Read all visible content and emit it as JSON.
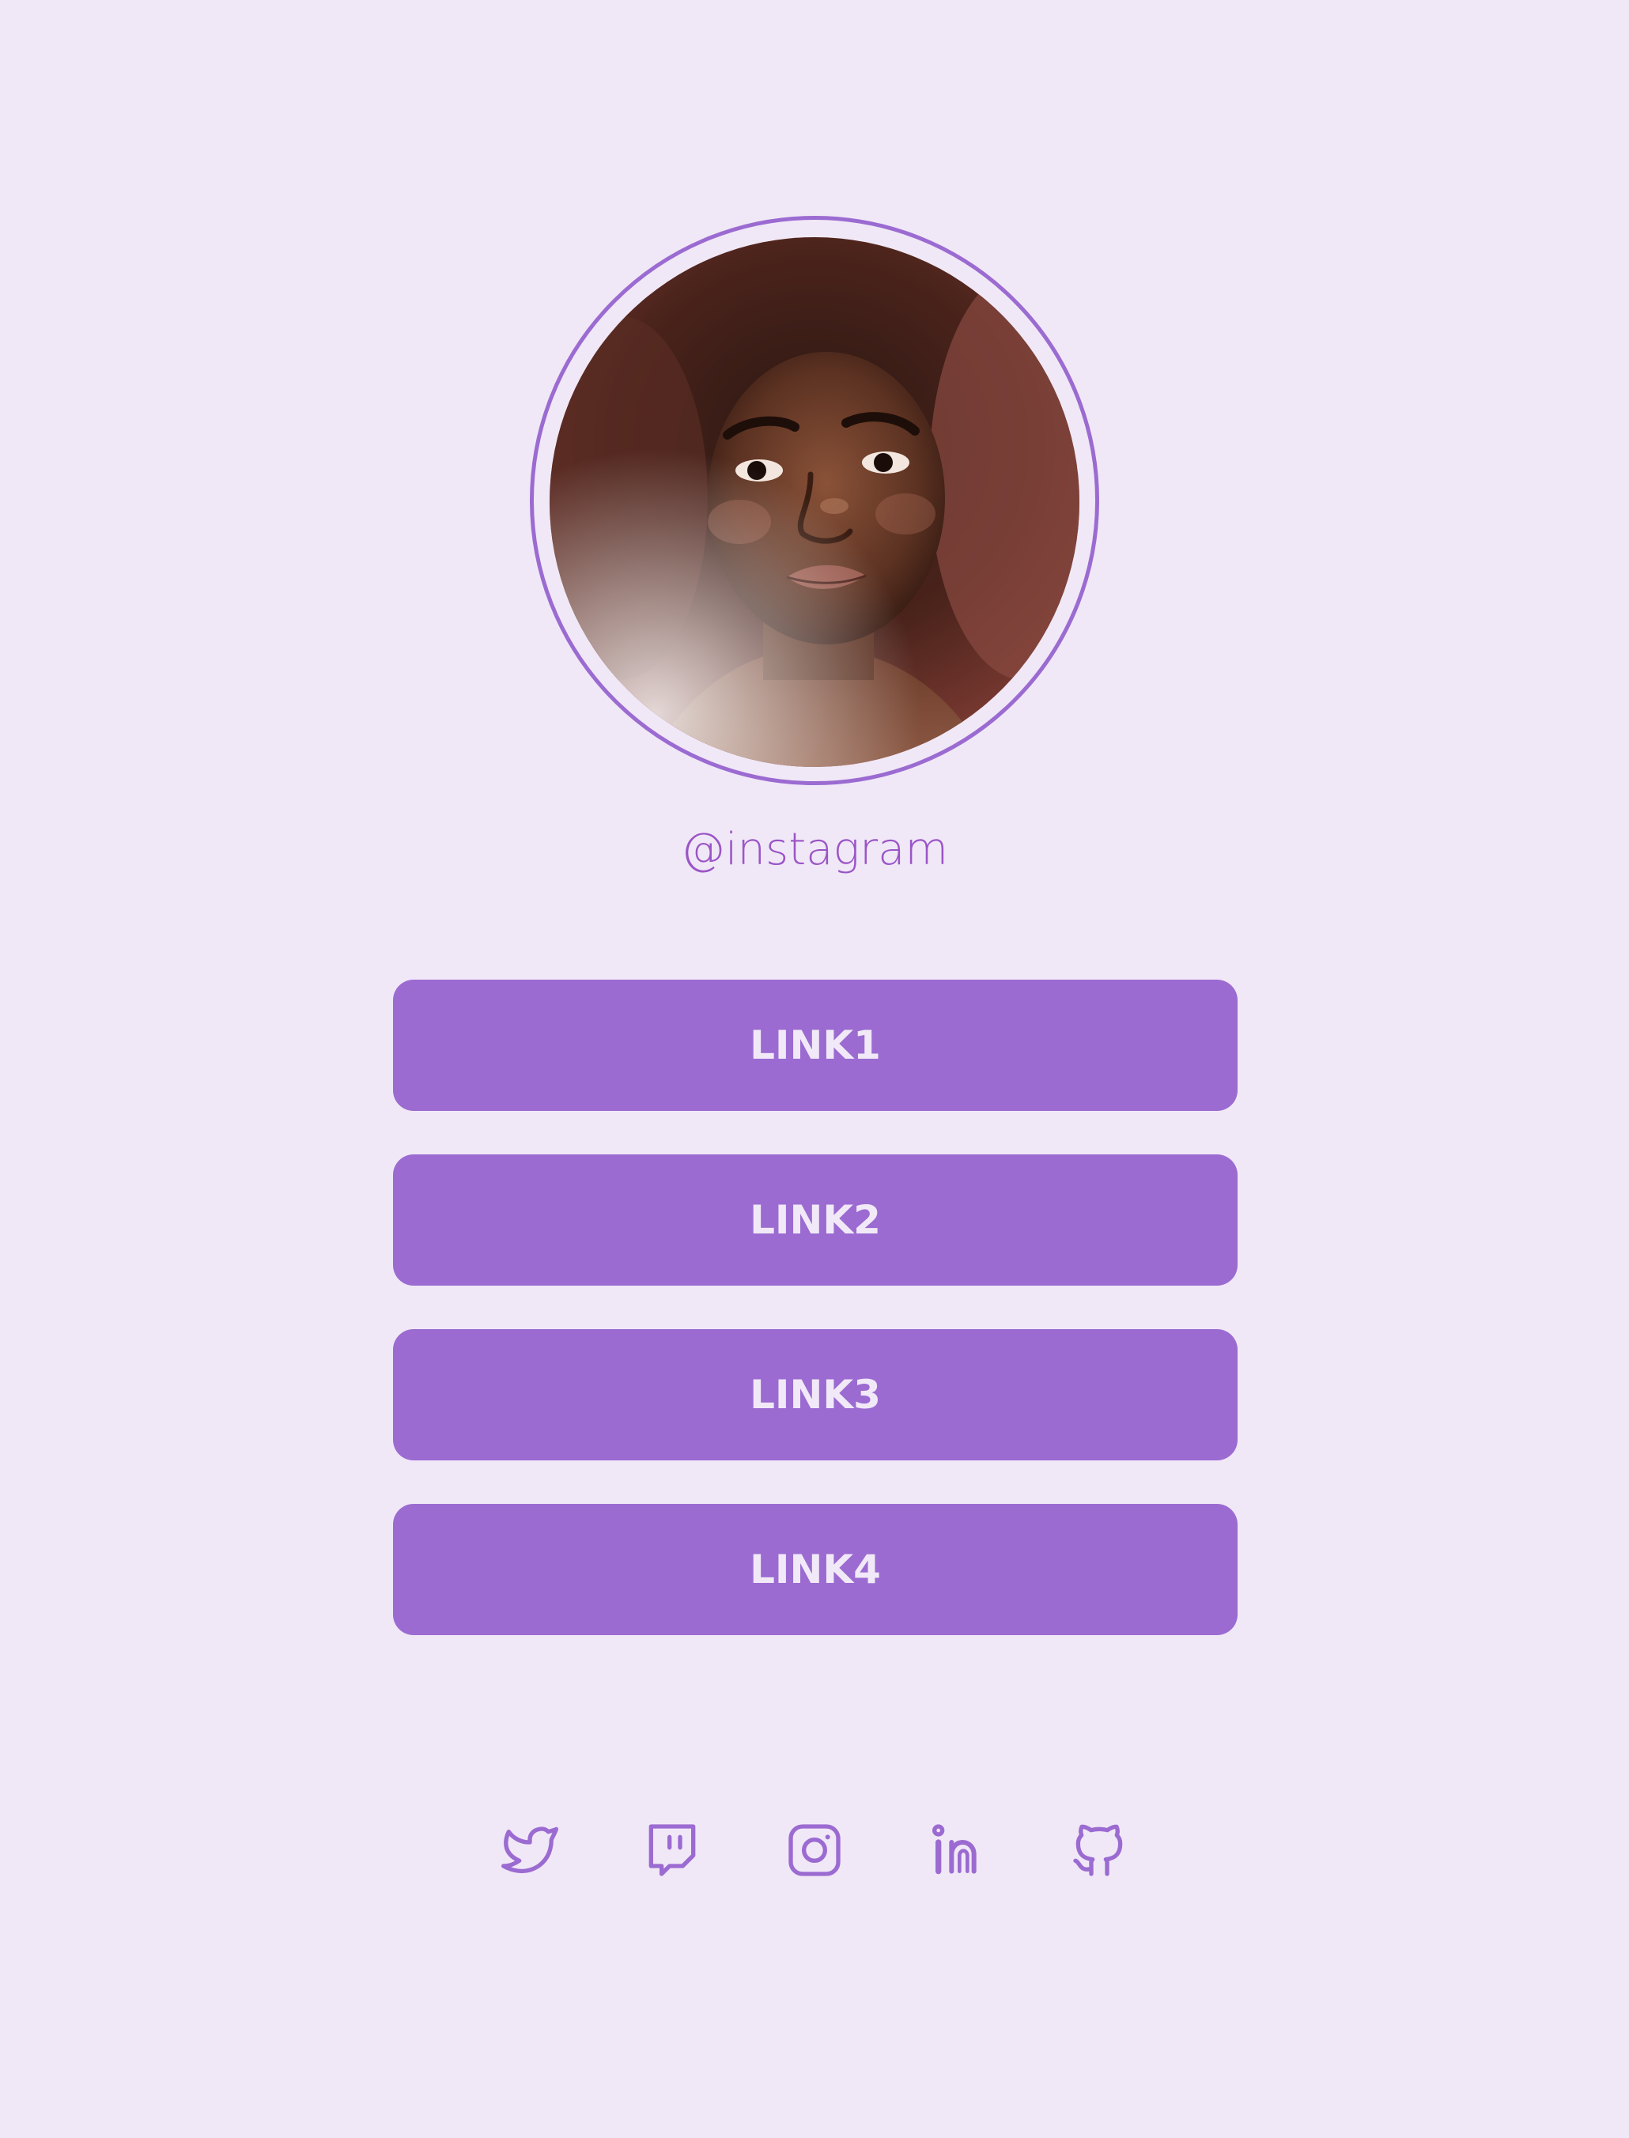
{
  "profile": {
    "handle": "@instagram"
  },
  "links": [
    {
      "label": "LINK1"
    },
    {
      "label": "LINK2"
    },
    {
      "label": "LINK3"
    },
    {
      "label": "LINK4"
    }
  ],
  "socials": [
    {
      "icon": "twitter-icon"
    },
    {
      "icon": "twitch-icon"
    },
    {
      "icon": "instagram-icon"
    },
    {
      "icon": "linkedin-icon"
    },
    {
      "icon": "github-icon"
    }
  ],
  "colors": {
    "background": "#f0e8f7",
    "accent": "#9b6bd1",
    "button_text": "#f1e9f7",
    "handle_text": "#9b55c6"
  }
}
